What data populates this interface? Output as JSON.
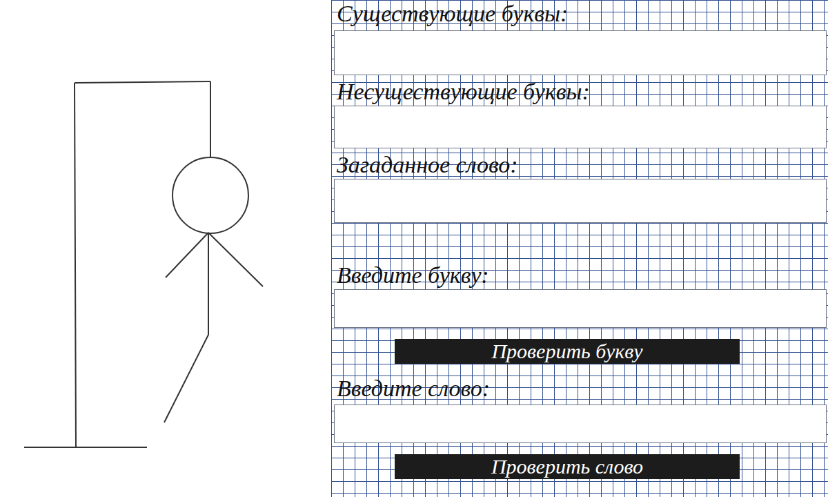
{
  "hangman": {
    "mistakes": 5,
    "max_mistakes": 6
  },
  "existing_letters": {
    "label": "Существующие буквы:",
    "value": ""
  },
  "missing_letters": {
    "label": "Несуществующие буквы:",
    "value": ""
  },
  "hidden_word": {
    "label": "Загаданное слово:",
    "value": ""
  },
  "letter_input": {
    "label": "Введите букву:",
    "value": "",
    "button": "Проверить букву"
  },
  "word_input": {
    "label": "Введите слово:",
    "value": "",
    "button": "Проверить слово"
  }
}
